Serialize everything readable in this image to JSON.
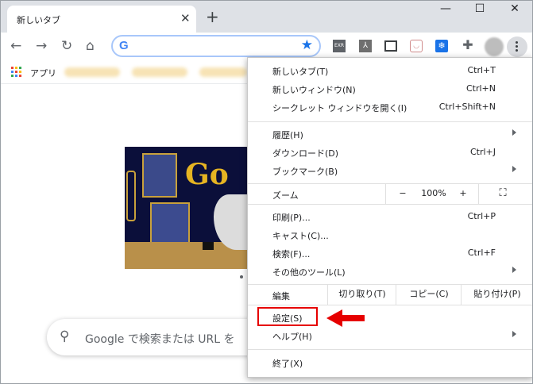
{
  "tab": {
    "title": "新しいタブ"
  },
  "toolbar": {
    "search_logo": "G",
    "ext_label": "EXR",
    "ext_label2": "⅄"
  },
  "bookmarks": {
    "apps_label": "アプリ"
  },
  "page": {
    "search_placeholder": "Google で検索または URL を"
  },
  "menu": {
    "items": [
      {
        "label": "新しいタブ(T)",
        "shortcut": "Ctrl+T"
      },
      {
        "label": "新しいウィンドウ(N)",
        "shortcut": "Ctrl+N"
      },
      {
        "label": "シークレット ウィンドウを開く(I)",
        "shortcut": "Ctrl+Shift+N"
      },
      {
        "label": "履歴(H)",
        "shortcut": ""
      },
      {
        "label": "ダウンロード(D)",
        "shortcut": "Ctrl+J"
      },
      {
        "label": "ブックマーク(B)",
        "shortcut": ""
      },
      {
        "label": "印刷(P)...",
        "shortcut": "Ctrl+P"
      },
      {
        "label": "キャスト(C)...",
        "shortcut": ""
      },
      {
        "label": "検索(F)...",
        "shortcut": "Ctrl+F"
      },
      {
        "label": "その他のツール(L)",
        "shortcut": ""
      },
      {
        "label": "設定(S)",
        "shortcut": ""
      },
      {
        "label": "ヘルプ(H)",
        "shortcut": ""
      },
      {
        "label": "終了(X)",
        "shortcut": ""
      }
    ],
    "zoom": {
      "label": "ズーム",
      "minus": "−",
      "value": "100%",
      "plus": "+"
    },
    "edit": {
      "label": "編集",
      "cut": "切り取り(T)",
      "copy": "コピー(C)",
      "paste": "貼り付け(P)"
    }
  },
  "colors": {
    "highlight": "#e60000",
    "accent": "#1a73e8"
  }
}
